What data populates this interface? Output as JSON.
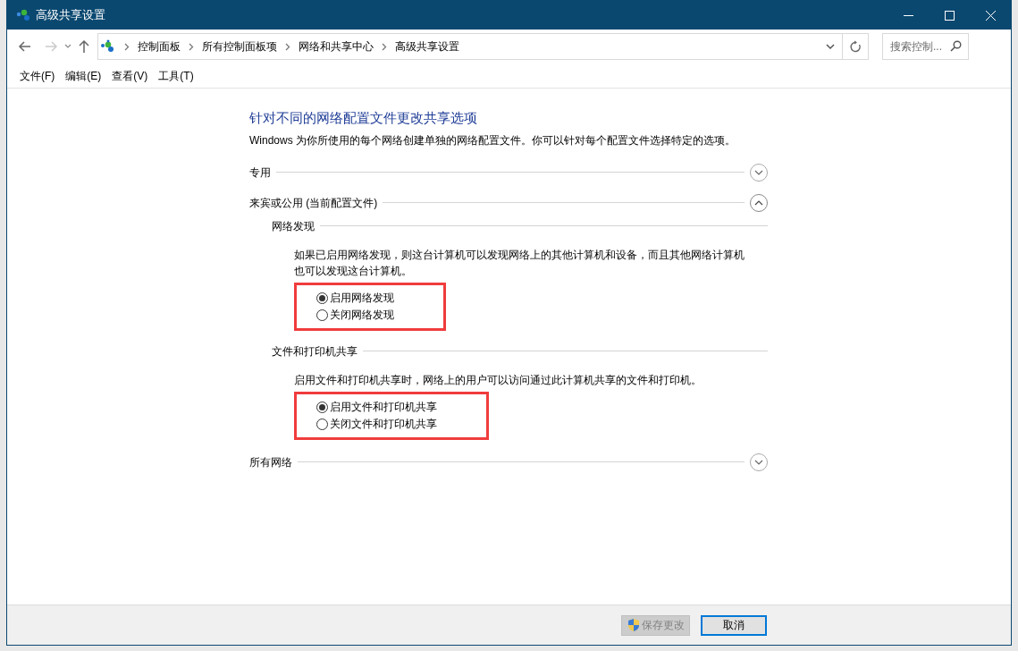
{
  "window": {
    "title": "高级共享设置"
  },
  "address_bar": {
    "breadcrumbs": [
      "控制面板",
      "所有控制面板项",
      "网络和共享中心",
      "高级共享设置"
    ]
  },
  "search": {
    "placeholder": "搜索控制..."
  },
  "menu": [
    "文件(F)",
    "编辑(E)",
    "查看(V)",
    "工具(T)"
  ],
  "heading": "针对不同的网络配置文件更改共享选项",
  "intro": "Windows 为你所使用的每个网络创建单独的网络配置文件。你可以针对每个配置文件选择特定的选项。",
  "profiles": [
    {
      "label": "专用",
      "expanded": false
    },
    {
      "label": "来宾或公用 (当前配置文件)",
      "expanded": true,
      "groups": [
        {
          "title": "网络发现",
          "description": "如果已启用网络发现，则这台计算机可以发现网络上的其他计算机和设备，而且其他网络计算机也可以发现这台计算机。",
          "annotated": true,
          "options": [
            {
              "label": "启用网络发现",
              "selected": true
            },
            {
              "label": "关闭网络发现",
              "selected": false
            }
          ]
        },
        {
          "title": "文件和打印机共享",
          "description": "启用文件和打印机共享时，网络上的用户可以访问通过此计算机共享的文件和打印机。",
          "annotated": true,
          "options": [
            {
              "label": "启用文件和打印机共享",
              "selected": true
            },
            {
              "label": "关闭文件和打印机共享",
              "selected": false
            }
          ]
        }
      ]
    },
    {
      "label": "所有网络",
      "expanded": false
    }
  ],
  "buttons": [
    {
      "label": "保存更改",
      "kind": "shield",
      "disabled": true
    },
    {
      "label": "取消",
      "kind": "plain",
      "disabled": false
    }
  ]
}
